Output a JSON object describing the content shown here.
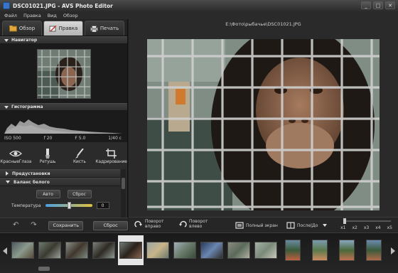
{
  "window": {
    "title": "DSC01021.JPG  -  AVS Photo Editor",
    "min_glyph": "_",
    "max_glyph": "□",
    "close_glyph": "✕"
  },
  "menu": [
    "Файл",
    "Правка",
    "Вид",
    "Обзор"
  ],
  "tabs": [
    {
      "label": "Обзор",
      "icon": "browse-icon",
      "active": false
    },
    {
      "label": "Правка",
      "icon": "edit-icon",
      "active": true
    },
    {
      "label": "Печать",
      "icon": "printer-icon",
      "active": false
    }
  ],
  "navigator": {
    "title": "Навигатор"
  },
  "histogram": {
    "title": "Гистограмма",
    "stats": {
      "iso": "ISO 500",
      "f": "f 20",
      "fstop": "F 5.0",
      "shutter": "1/40 с"
    }
  },
  "tools": [
    {
      "label": "КрасныеГлаза",
      "icon": "eye-icon"
    },
    {
      "label": "Ретушь",
      "icon": "retouch-icon"
    },
    {
      "label": "Кисть",
      "icon": "brush-icon"
    },
    {
      "label": "Кадрирование",
      "icon": "crop-icon"
    }
  ],
  "presets": {
    "title": "Предустановки"
  },
  "white_balance": {
    "title": "Баланс белого",
    "auto_label": "Авто",
    "reset_label": "Сброс",
    "temperature_label": "Температура",
    "temperature_value": "0"
  },
  "bottom_left": {
    "save_label": "Сохранить",
    "reset_label": "Сброс",
    "undo_glyph": "↶",
    "redo_glyph": "↷"
  },
  "file_path": "E:\\Фото\\рыбачье\\DSC01021.JPG",
  "right_toolbar": {
    "rotate_right": "Поворот вправо",
    "rotate_left": "Поворот влево",
    "fullscreen": "Полный экран",
    "before_after": "После|До",
    "zoom_levels": [
      "x1",
      "x2",
      "x3",
      "x4",
      "x5"
    ]
  },
  "filmstrip": {
    "count": 14,
    "selected_index": 4
  }
}
